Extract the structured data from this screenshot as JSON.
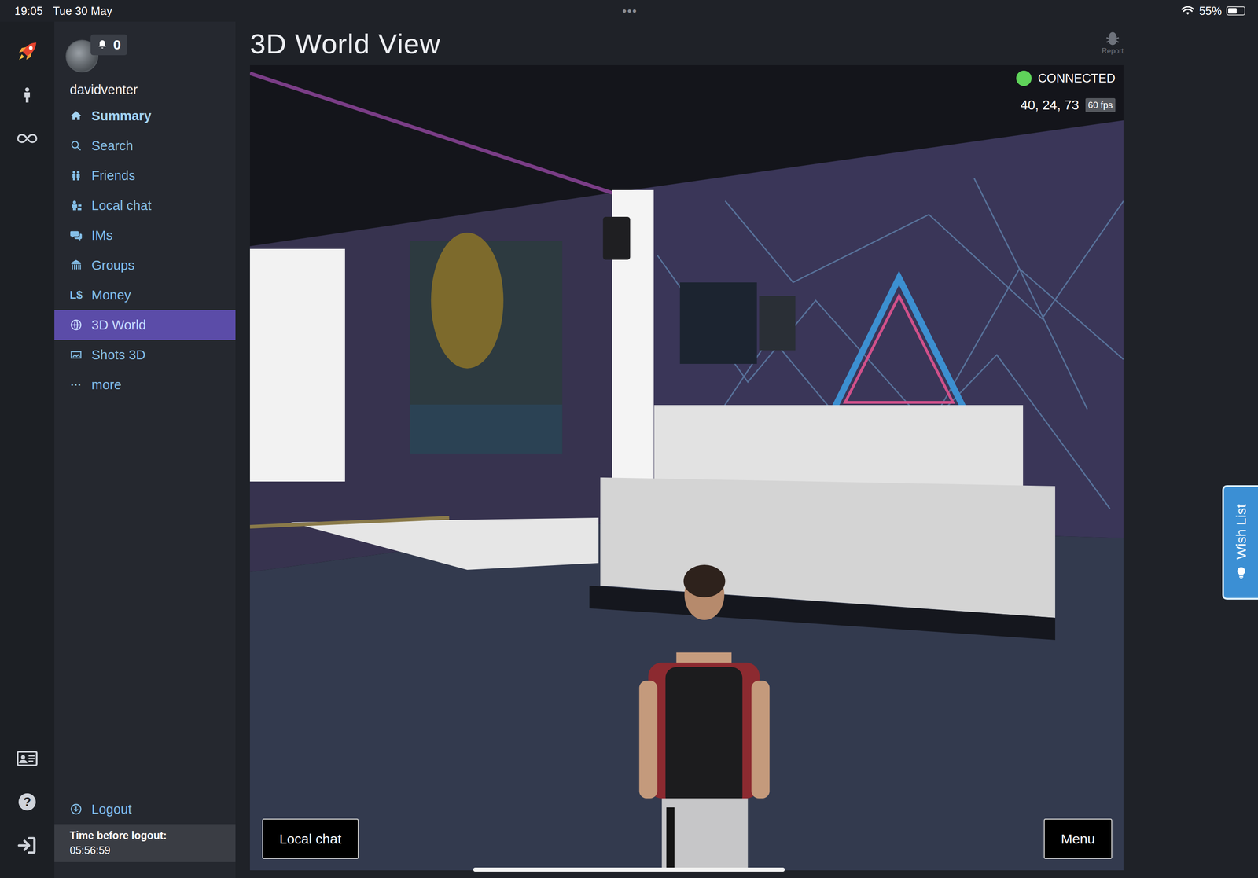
{
  "status_bar": {
    "time": "19:05",
    "date": "Tue 30 May",
    "handle": "•••",
    "battery": "55%",
    "battery_level": 0.55,
    "wifi": true
  },
  "rail": {
    "help_glyph": "?"
  },
  "profile": {
    "username": "davidventer",
    "notifications": "0"
  },
  "sidebar": {
    "items": [
      {
        "label": "Summary",
        "emphasized": true,
        "selected": false
      },
      {
        "label": "Search",
        "emphasized": false,
        "selected": false
      },
      {
        "label": "Friends",
        "emphasized": false,
        "selected": false
      },
      {
        "label": "Local chat",
        "emphasized": false,
        "selected": false
      },
      {
        "label": "IMs",
        "emphasized": false,
        "selected": false
      },
      {
        "label": "Groups",
        "emphasized": false,
        "selected": false
      },
      {
        "label": "Money",
        "glyph": "L$",
        "emphasized": false,
        "selected": false
      },
      {
        "label": "3D World",
        "emphasized": false,
        "selected": true
      },
      {
        "label": "Shots 3D",
        "emphasized": false,
        "selected": false
      },
      {
        "label": "more",
        "glyph": "···",
        "emphasized": false,
        "selected": false
      }
    ]
  },
  "logout": {
    "label": "Logout",
    "timer_label": "Time before logout:",
    "timer": "05:56:59"
  },
  "page": {
    "title": "3D World View",
    "report": "Report"
  },
  "viewer": {
    "status": "CONNECTED",
    "connected": true,
    "coords": "40, 24, 73",
    "fps": "60 fps",
    "buttons": [
      "Local chat",
      "Menu"
    ]
  },
  "wish_list": {
    "label": "Wish List"
  }
}
